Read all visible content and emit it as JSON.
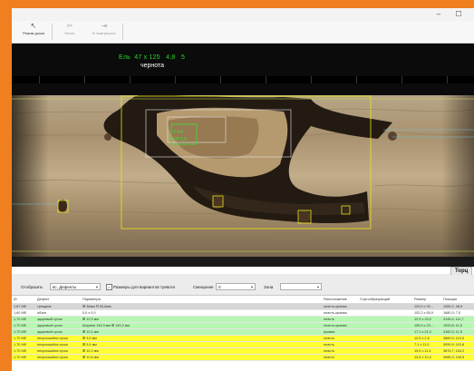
{
  "titlebar": {
    "minimize": "–",
    "maximize": "☐"
  },
  "toolbar": {
    "buttons": [
      {
        "icon": "↖",
        "label": "Режим доски",
        "enabled": true
      },
      {
        "icon": "✂",
        "label": "Налог",
        "enabled": false
      },
      {
        "icon": "⇥",
        "label": "В «матрицах»",
        "enabled": false
      }
    ]
  },
  "viewer": {
    "spec_line": "Ель  47 х 125   4,8   5",
    "grade": "чернота",
    "inner_label1": "T 4,6",
    "inner_label2": "КП 0,5"
  },
  "bottom_tab": "Торц",
  "filter": {
    "label": "Отобразить",
    "value": "вс. Дефекты",
    "checkbox_label": "Размеры для вариантов тревоги",
    "smeshenie_label": "Смещение",
    "smeshenie_value": "0",
    "zona_label": "Зона",
    "zona_value": ""
  },
  "table": {
    "columns": [
      "ID",
      "Дефект",
      "Параметры",
      "Расположение",
      "Сортообразующий",
      "Размер",
      "Позиция"
    ],
    "rows": [
      {
        "style": "sel",
        "cells": [
          "1,67 Мб",
          "трещина",
          "⊞ 36мм  ⊡ 50,6мм",
          "пласть-кромка",
          "",
          "102,0 x 92...",
          "1265,2; 46,5"
        ]
      },
      {
        "style": "plain",
        "cells": [
          "1,60 Мб",
          "обзол",
          "0,0 x 0,0",
          "пласть-кромка",
          "",
          "102,2 x 65,9",
          "1680,3; 7,5"
        ]
      },
      {
        "style": "green",
        "cells": [
          "1,70 Мб",
          "здоровый сучок",
          "⊞ 12,9 мм",
          "пласть",
          "",
          "12,9 x 15,0",
          "3145,4; 111,7"
        ]
      },
      {
        "style": "green",
        "cells": [
          "1,70 Мб",
          "здоровый сучок",
          "Ширина 149,3 мм  ⊞ 149,3 мм",
          "пласть-кромка",
          "",
          "159,9 x 23...",
          "1020,8; 11,5"
        ]
      },
      {
        "style": "green",
        "cells": [
          "1,70 Мб",
          "здоровый сучок",
          "⊞ 10,1 мм",
          "кромка",
          "",
          "17,1 x 21,0",
          "4160,3; 11,5"
        ]
      },
      {
        "style": "yellow",
        "cells": [
          "1,70 Мб",
          "несросшийся сучок",
          "⊞ 3,5 мм",
          "пласть",
          "",
          "10,5 x 2,6",
          "3880,9; 115,5"
        ]
      },
      {
        "style": "yellow",
        "cells": [
          "1,70 Мб",
          "несросшийся сучок",
          "⊞ 5,4 мм",
          "пласть",
          "",
          "7,1 x 11,3",
          "3090,9; 115,8"
        ]
      },
      {
        "style": "yellow",
        "cells": [
          "1,70 Мб",
          "несросшийся сучок",
          "⊞ 10,2 мм",
          "пласть",
          "",
          "10,5 x 11,4",
          "3875,7; 104,2"
        ]
      },
      {
        "style": "yellow",
        "cells": [
          "1,70 Мб",
          "несросшийся сучок",
          "⊞ 10,6 мм",
          "пласть",
          "",
          "10,5 x 10,4",
          "3985,3; 109,5"
        ]
      }
    ]
  }
}
